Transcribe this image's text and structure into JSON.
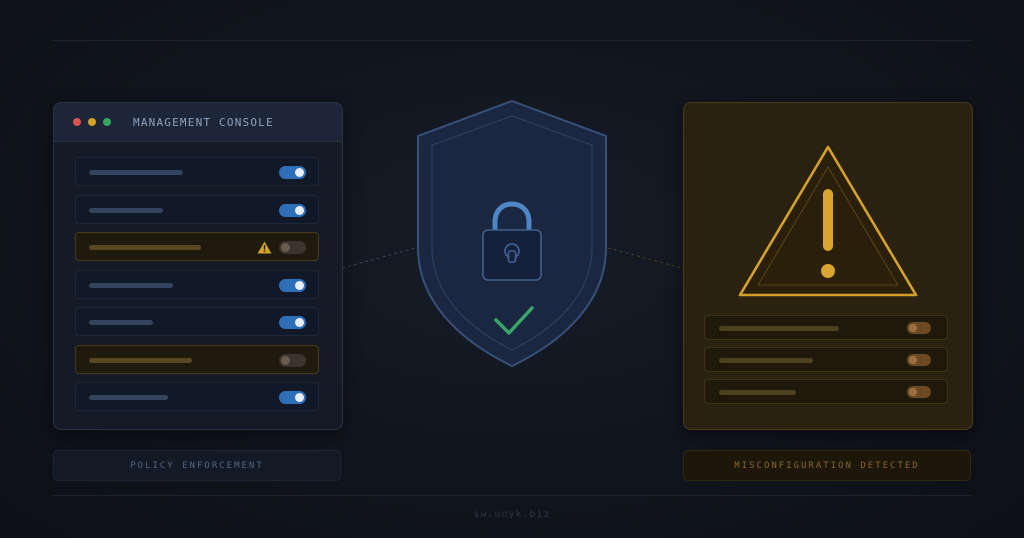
{
  "console": {
    "title": "MANAGEMENT CONSOLE",
    "rows": [
      {
        "state": "on"
      },
      {
        "state": "on"
      },
      {
        "state": "warning"
      },
      {
        "state": "on"
      },
      {
        "state": "on"
      },
      {
        "state": "warning"
      },
      {
        "state": "on"
      }
    ]
  },
  "labels": {
    "left": "POLICY ENFORCEMENT",
    "right": "MISCONFIGURATION DETECTED"
  },
  "footer": {
    "text": "sw.unyk.biz"
  },
  "alert": {
    "rows": [
      {
        "state": "off"
      },
      {
        "state": "off"
      },
      {
        "state": "off"
      }
    ]
  },
  "icons": {
    "center": "shield-lock-check-icon",
    "alert": "warning-triangle-icon"
  },
  "colors": {
    "accent_blue": "#2f6fb8",
    "warning_amber": "#d4a12a",
    "success_green": "#3aa55c",
    "danger_red": "#d9534f"
  }
}
